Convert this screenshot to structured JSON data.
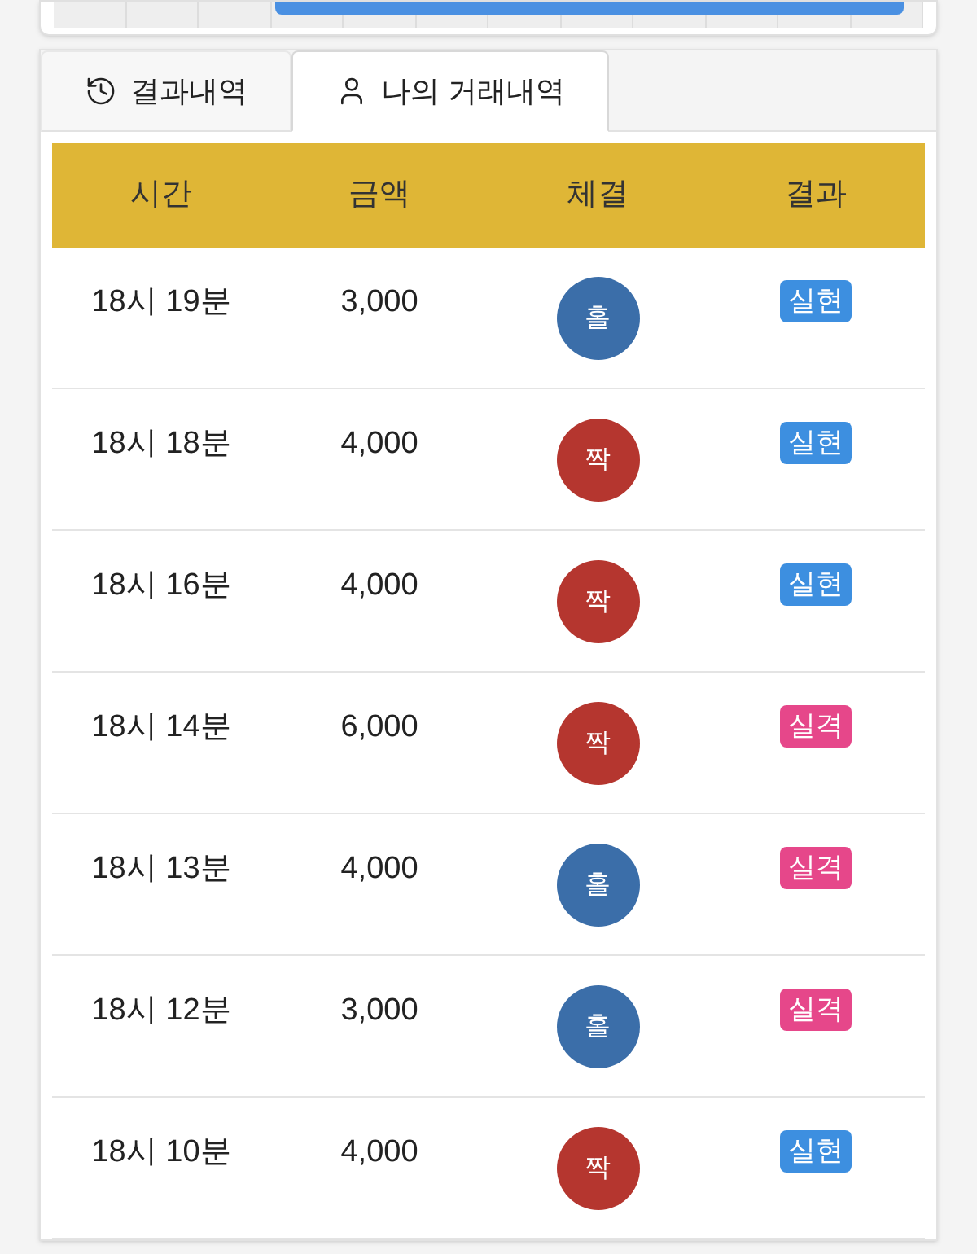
{
  "tabs": [
    {
      "label": "결과내역",
      "kind": "history",
      "selected": false
    },
    {
      "label": "나의 거래내역",
      "kind": "user",
      "selected": true
    }
  ],
  "table": {
    "columns": [
      "시간",
      "금액",
      "체결",
      "결과"
    ],
    "rows": [
      {
        "time": "18시 19분",
        "amount": "3,000",
        "ball": {
          "label": "홀",
          "kind": "odd"
        },
        "result": {
          "label": "실현",
          "kind": "win"
        }
      },
      {
        "time": "18시 18분",
        "amount": "4,000",
        "ball": {
          "label": "짝",
          "kind": "even"
        },
        "result": {
          "label": "실현",
          "kind": "win"
        }
      },
      {
        "time": "18시 16분",
        "amount": "4,000",
        "ball": {
          "label": "짝",
          "kind": "even"
        },
        "result": {
          "label": "실현",
          "kind": "win"
        }
      },
      {
        "time": "18시 14분",
        "amount": "6,000",
        "ball": {
          "label": "짝",
          "kind": "even"
        },
        "result": {
          "label": "실격",
          "kind": "loss"
        }
      },
      {
        "time": "18시 13분",
        "amount": "4,000",
        "ball": {
          "label": "홀",
          "kind": "odd"
        },
        "result": {
          "label": "실격",
          "kind": "loss"
        }
      },
      {
        "time": "18시 12분",
        "amount": "3,000",
        "ball": {
          "label": "홀",
          "kind": "odd"
        },
        "result": {
          "label": "실격",
          "kind": "loss"
        }
      },
      {
        "time": "18시 10분",
        "amount": "4,000",
        "ball": {
          "label": "짝",
          "kind": "even"
        },
        "result": {
          "label": "실현",
          "kind": "win"
        }
      }
    ]
  }
}
